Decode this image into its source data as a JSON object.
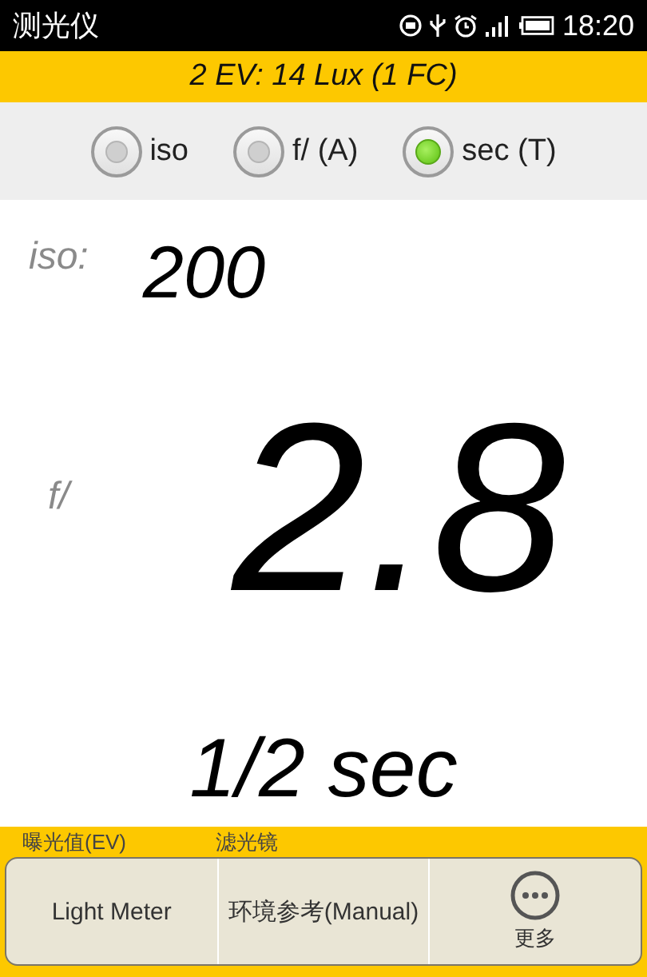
{
  "status_bar": {
    "app_title": "测光仪",
    "time": "18:20"
  },
  "ev_bar": {
    "text": "2 EV: 14 Lux (1 FC)"
  },
  "modes": [
    {
      "label": "iso",
      "selected": false
    },
    {
      "label": "f/ (A)",
      "selected": false
    },
    {
      "label": "sec (T)",
      "selected": true
    }
  ],
  "readings": [
    {
      "kind": "iso",
      "label": "iso:",
      "value": "200"
    },
    {
      "kind": "aperture",
      "label": "f/",
      "value": "2.8"
    },
    {
      "kind": "shutter",
      "value": "1/2 sec"
    }
  ],
  "bottom_labels": [
    "曝光值(EV)",
    "滤光镜"
  ],
  "menu": {
    "items": [
      {
        "kind": "text",
        "label": "Light Meter"
      },
      {
        "kind": "text",
        "label": "环境参考(Manual)"
      },
      {
        "kind": "more",
        "label": "更多"
      }
    ]
  }
}
